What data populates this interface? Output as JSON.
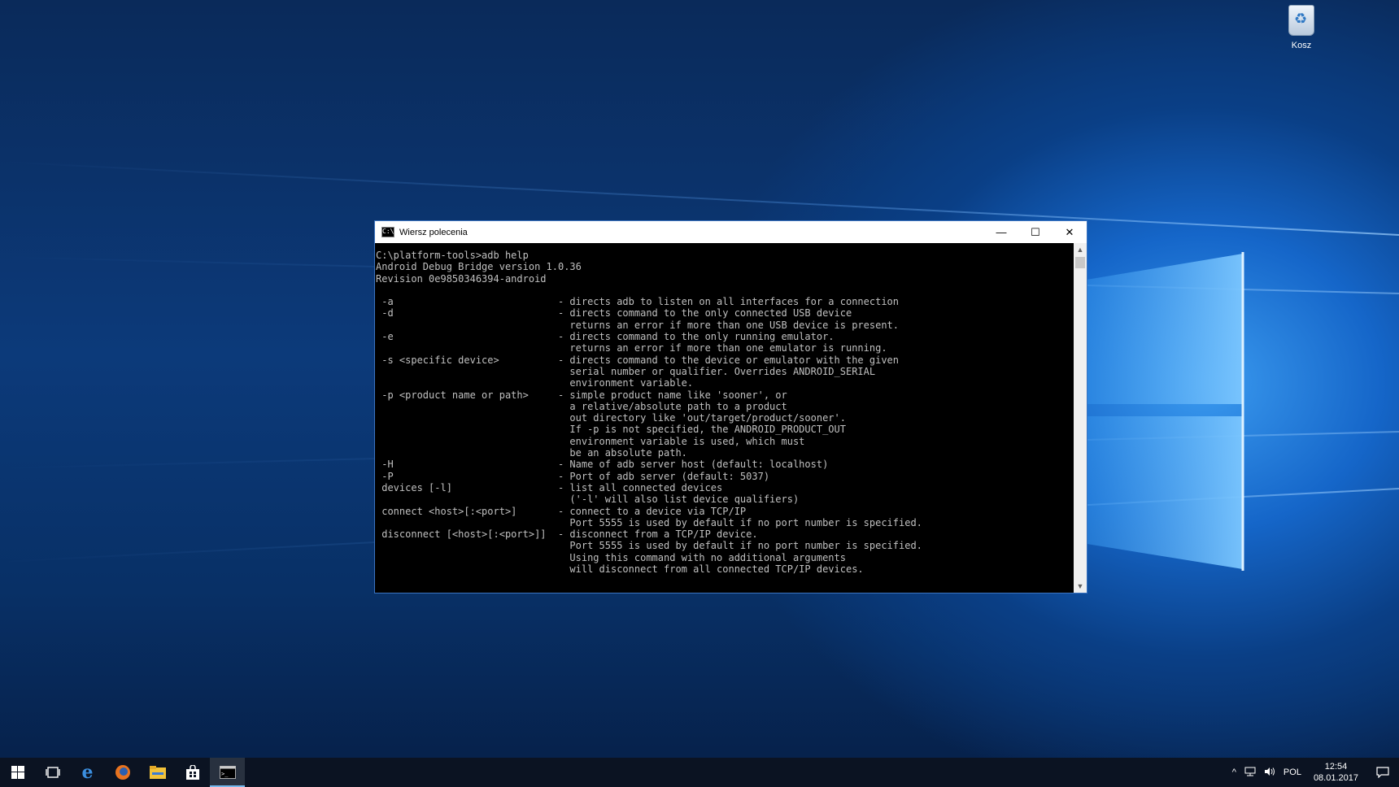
{
  "desktop": {
    "recycle_bin_label": "Kosz"
  },
  "window": {
    "title": "Wiersz polecenia",
    "minimize": "—",
    "maximize": "☐",
    "close": "✕"
  },
  "console": {
    "lines": [
      "C:\\platform-tools>adb help",
      "Android Debug Bridge version 1.0.36",
      "Revision 0e9850346394-android",
      "",
      " -a                            - directs adb to listen on all interfaces for a connection",
      " -d                            - directs command to the only connected USB device",
      "                                 returns an error if more than one USB device is present.",
      " -e                            - directs command to the only running emulator.",
      "                                 returns an error if more than one emulator is running.",
      " -s <specific device>          - directs command to the device or emulator with the given",
      "                                 serial number or qualifier. Overrides ANDROID_SERIAL",
      "                                 environment variable.",
      " -p <product name or path>     - simple product name like 'sooner', or",
      "                                 a relative/absolute path to a product",
      "                                 out directory like 'out/target/product/sooner'.",
      "                                 If -p is not specified, the ANDROID_PRODUCT_OUT",
      "                                 environment variable is used, which must",
      "                                 be an absolute path.",
      " -H                            - Name of adb server host (default: localhost)",
      " -P                            - Port of adb server (default: 5037)",
      " devices [-l]                  - list all connected devices",
      "                                 ('-l' will also list device qualifiers)",
      " connect <host>[:<port>]       - connect to a device via TCP/IP",
      "                                 Port 5555 is used by default if no port number is specified.",
      " disconnect [<host>[:<port>]]  - disconnect from a TCP/IP device.",
      "                                 Port 5555 is used by default if no port number is specified.",
      "                                 Using this command with no additional arguments",
      "                                 will disconnect from all connected TCP/IP devices."
    ]
  },
  "taskbar": {
    "items": [
      "start-icon",
      "task-view-icon",
      "edge-icon",
      "firefox-icon",
      "file-explorer-icon",
      "store-icon",
      "cmd-icon"
    ],
    "tray": {
      "chevron": "^",
      "language": "POL",
      "time": "12:54",
      "date": "08.01.2017"
    }
  }
}
